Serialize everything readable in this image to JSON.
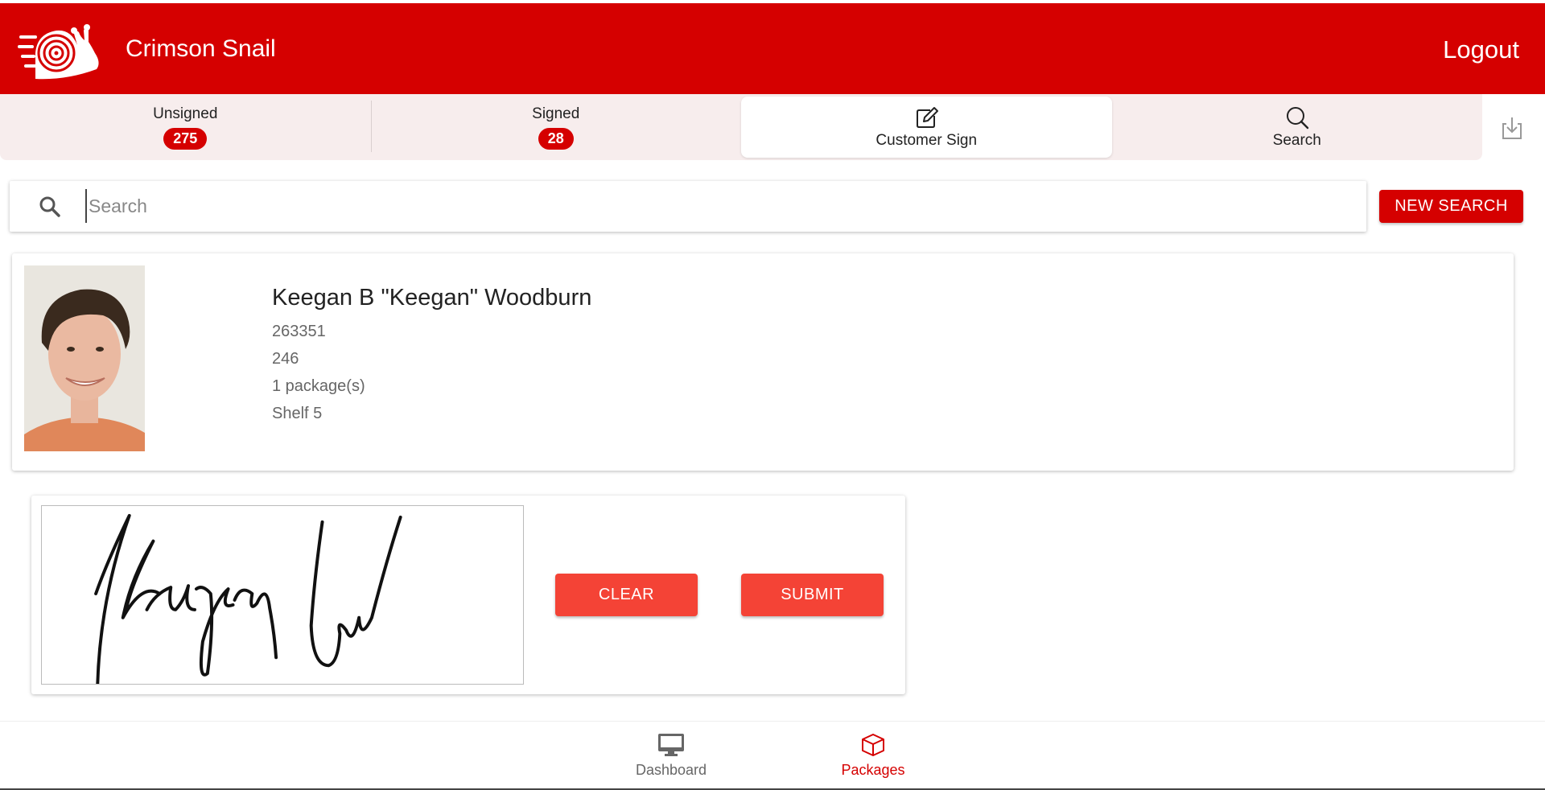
{
  "header": {
    "app_name": "Crimson Snail",
    "logout_label": "Logout",
    "logo_icon": "snail-logo-icon",
    "color": "#d50000"
  },
  "tabs": [
    {
      "label": "Unsigned",
      "badge": "275"
    },
    {
      "label": "Signed",
      "badge": "28"
    },
    {
      "label": "Customer Sign",
      "icon": "edit-icon",
      "active": true
    },
    {
      "label": "Search",
      "icon": "search-icon"
    }
  ],
  "toolbar": {
    "download_icon": "download-icon"
  },
  "search": {
    "placeholder": "Search",
    "value": "",
    "new_search_label": "NEW SEARCH"
  },
  "customer": {
    "name": "Keegan B \"Keegan\" Woodburn",
    "id": "263351",
    "box": "246",
    "packages": "1 package(s)",
    "shelf": "Shelf 5"
  },
  "signature": {
    "clear_label": "CLEAR",
    "submit_label": "SUBMIT",
    "accent": "#f44336"
  },
  "nav": [
    {
      "label": "Dashboard",
      "icon": "desktop-icon",
      "active": false
    },
    {
      "label": "Packages",
      "icon": "box-icon",
      "active": true
    }
  ]
}
